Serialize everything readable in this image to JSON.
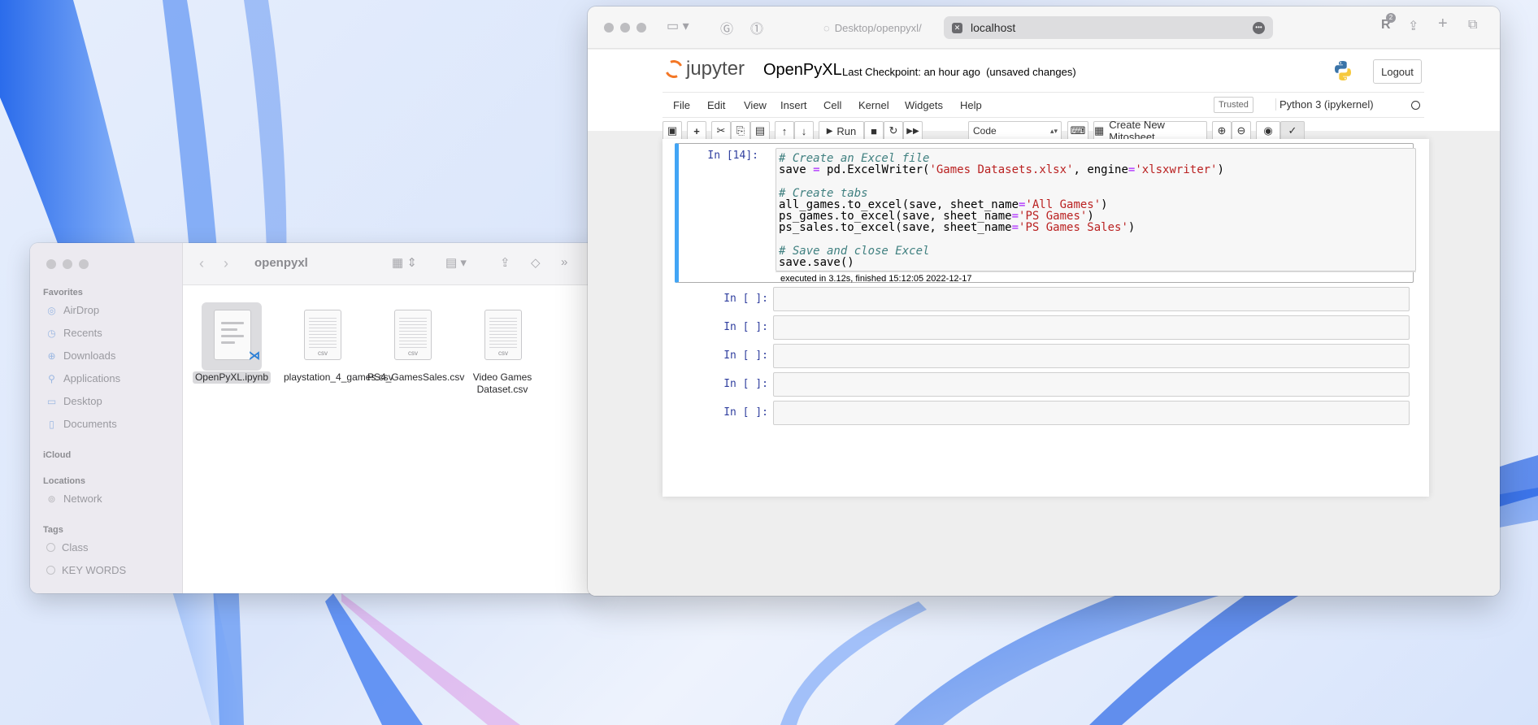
{
  "finder": {
    "title": "openpyxl",
    "sidebar": {
      "favorites_label": "Favorites",
      "favorites": [
        "AirDrop",
        "Recents",
        "Downloads",
        "Applications",
        "Desktop",
        "Documents"
      ],
      "icloud_label": "iCloud",
      "locations_label": "Locations",
      "locations": [
        "Network"
      ],
      "tags_label": "Tags",
      "tags": [
        "Class",
        "KEY WORDS"
      ]
    },
    "files": [
      {
        "name": "OpenPyXL.ipynb",
        "type": "ipynb"
      },
      {
        "name": "playstation_4_games.csv",
        "type": "csv"
      },
      {
        "name": "PS4_GamesSales.csv",
        "type": "csv"
      },
      {
        "name": "Video Games Dataset.csv",
        "type": "csv"
      }
    ],
    "csv_tag": "csv"
  },
  "browser": {
    "inactive_tab": "Desktop/openpyxl/",
    "active_tab": "localhost",
    "badge_count": "2"
  },
  "jupyter": {
    "logo_text": "jupyter",
    "notebook_name": "OpenPyXL",
    "checkpoint": "Last Checkpoint: an hour ago",
    "unsaved": "(unsaved changes)",
    "logout_label": "Logout",
    "menu": [
      "File",
      "Edit",
      "View",
      "Insert",
      "Cell",
      "Kernel",
      "Widgets",
      "Help"
    ],
    "trusted_label": "Trusted",
    "kernel_name": "Python 3 (ipykernel)",
    "toolbar": {
      "run_label": "Run",
      "cell_type": "Code",
      "mitosheet_label": "Create New Mitosheet"
    },
    "cells": {
      "executed_prompt": "In [14]:",
      "code_lines": [
        {
          "parts": [
            {
              "t": "# Create an Excel file",
              "c": "cm"
            }
          ]
        },
        {
          "parts": [
            {
              "t": "save ",
              "c": ""
            },
            {
              "t": "=",
              "c": "op"
            },
            {
              "t": " pd.ExcelWriter(",
              "c": ""
            },
            {
              "t": "'Games Datasets.xlsx'",
              "c": "st"
            },
            {
              "t": ", engine",
              "c": ""
            },
            {
              "t": "=",
              "c": "op"
            },
            {
              "t": "'xlsxwriter'",
              "c": "st"
            },
            {
              "t": ")",
              "c": ""
            }
          ]
        },
        {
          "parts": []
        },
        {
          "parts": [
            {
              "t": "# Create tabs",
              "c": "cm"
            }
          ]
        },
        {
          "parts": [
            {
              "t": "all_games.to_excel(save, sheet_name",
              "c": ""
            },
            {
              "t": "=",
              "c": "op"
            },
            {
              "t": "'All Games'",
              "c": "st"
            },
            {
              "t": ")",
              "c": ""
            }
          ]
        },
        {
          "parts": [
            {
              "t": "ps_games.to_excel(save, sheet_name",
              "c": ""
            },
            {
              "t": "=",
              "c": "op"
            },
            {
              "t": "'PS Games'",
              "c": "st"
            },
            {
              "t": ")",
              "c": ""
            }
          ]
        },
        {
          "parts": [
            {
              "t": "ps_sales.to_excel(save, sheet_name",
              "c": ""
            },
            {
              "t": "=",
              "c": "op"
            },
            {
              "t": "'PS Games Sales'",
              "c": "st"
            },
            {
              "t": ")",
              "c": ""
            }
          ]
        },
        {
          "parts": []
        },
        {
          "parts": [
            {
              "t": "# Save and close Excel",
              "c": "cm"
            }
          ]
        },
        {
          "parts": [
            {
              "t": "save.save()",
              "c": ""
            }
          ]
        }
      ],
      "exec_info": "executed in 3.12s, finished 15:12:05 2022-12-17",
      "empty_prompt": "In [ ]:",
      "empty_count": 5
    }
  },
  "colors": {
    "selected_cell_border": "#42a5f5",
    "jupyter_orange": "#f37726",
    "prompt_blue": "#303f9f"
  }
}
